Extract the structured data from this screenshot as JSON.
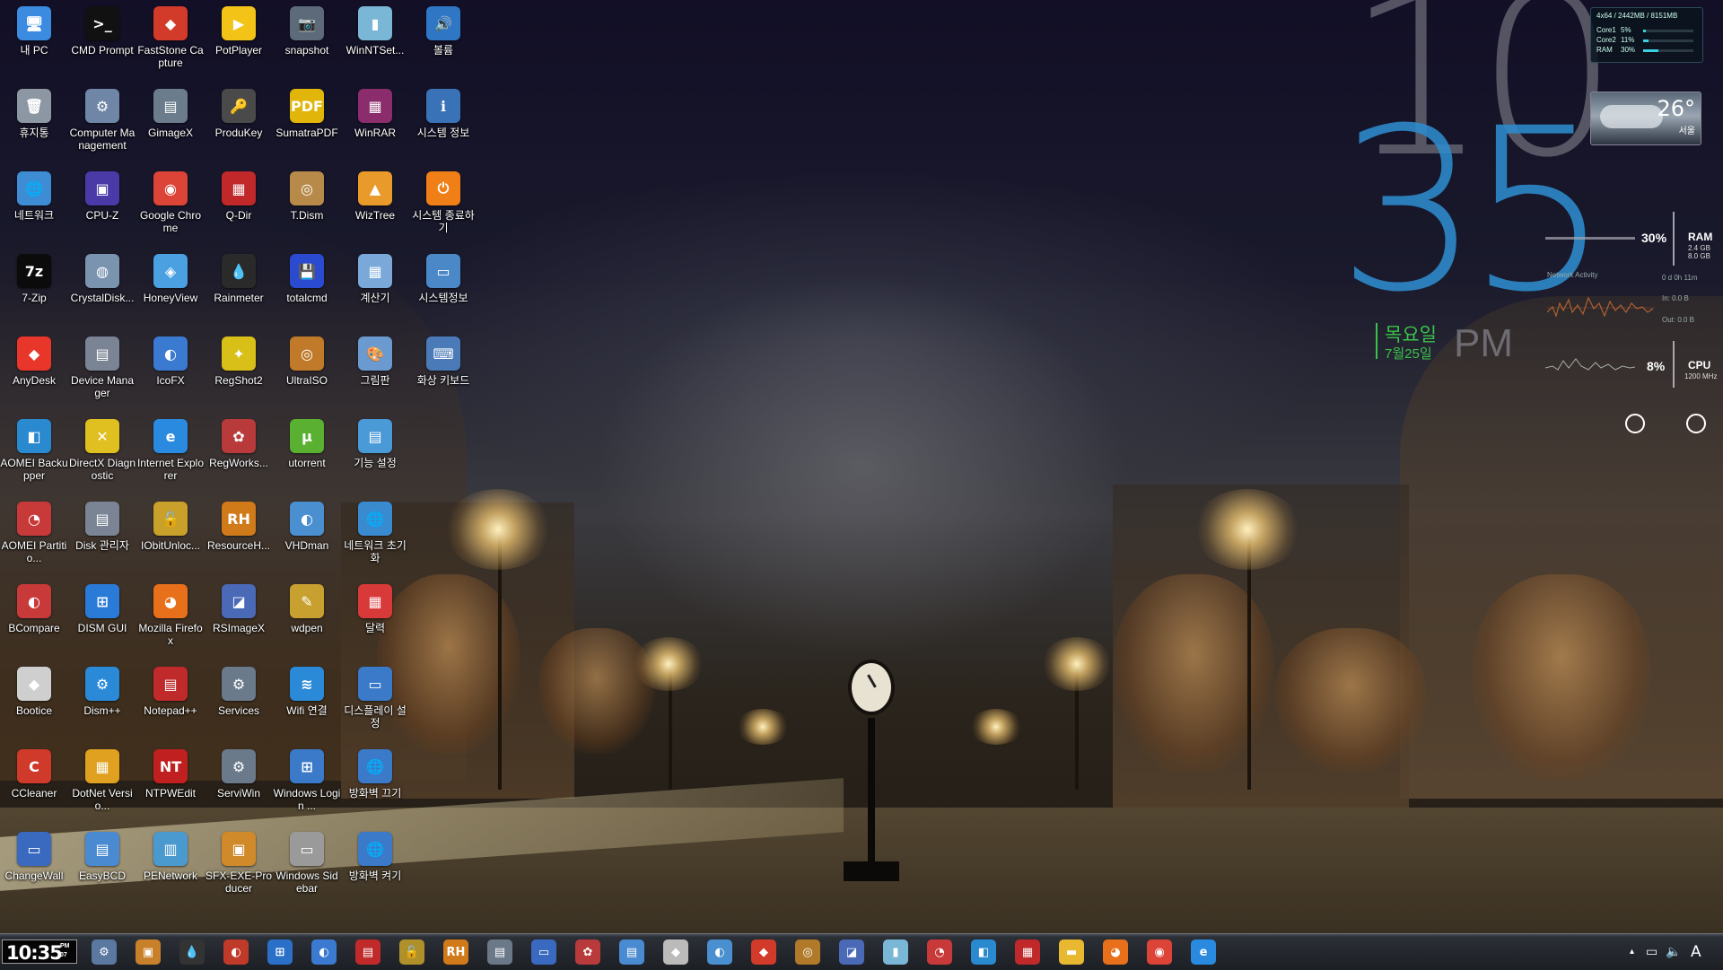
{
  "desktop": {
    "icons": [
      {
        "label": "내 PC",
        "glyph": "🖥",
        "color": "#3b8be0"
      },
      {
        "label": "CMD Prompt",
        "glyph": ">_",
        "color": "#111111"
      },
      {
        "label": "FastStone Capture",
        "glyph": "◆",
        "color": "#d23a2a"
      },
      {
        "label": "PotPlayer",
        "glyph": "▶",
        "color": "#f3c318"
      },
      {
        "label": "snapshot",
        "glyph": "📷",
        "color": "#5c6a7a"
      },
      {
        "label": "WinNTSet...",
        "glyph": "▮",
        "color": "#7ab6d6"
      },
      {
        "label": "볼륨",
        "glyph": "🔊",
        "color": "#2f76c4"
      },
      {
        "label": "휴지통",
        "glyph": "🗑",
        "color": "#8d97a3"
      },
      {
        "label": "Computer Management",
        "glyph": "⚙",
        "color": "#6f86a6"
      },
      {
        "label": "GimageX",
        "glyph": "▤",
        "color": "#6b7d8c"
      },
      {
        "label": "ProduKey",
        "glyph": "🔑",
        "color": "#4a4a4a"
      },
      {
        "label": "SumatraPDF",
        "glyph": "PDF",
        "color": "#e2b50a"
      },
      {
        "label": "WinRAR",
        "glyph": "▦",
        "color": "#8b2d6c"
      },
      {
        "label": "시스템 정보",
        "glyph": "ℹ",
        "color": "#3a72b8"
      },
      {
        "label": "네트워크",
        "glyph": "🌐",
        "color": "#3e8cd4"
      },
      {
        "label": "CPU-Z",
        "glyph": "▣",
        "color": "#4a3aa8"
      },
      {
        "label": "Google Chrome",
        "glyph": "◉",
        "color": "#db4437"
      },
      {
        "label": "Q-Dir",
        "glyph": "▦",
        "color": "#c0282a"
      },
      {
        "label": "T.Dism",
        "glyph": "◎",
        "color": "#b88a4a"
      },
      {
        "label": "WizTree",
        "glyph": "▲",
        "color": "#e89a2a"
      },
      {
        "label": "시스템 종료하기",
        "glyph": "⏻",
        "color": "#f07f18"
      },
      {
        "label": "7-Zip",
        "glyph": "7z",
        "color": "#0b0b0b"
      },
      {
        "label": "CrystalDisk...",
        "glyph": "◍",
        "color": "#7a94b0"
      },
      {
        "label": "HoneyView",
        "glyph": "◈",
        "color": "#4aa0e0"
      },
      {
        "label": "Rainmeter",
        "glyph": "💧",
        "color": "#2a2a2a"
      },
      {
        "label": "totalcmd",
        "glyph": "💾",
        "color": "#2a4ad0"
      },
      {
        "label": "계산기",
        "glyph": "▦",
        "color": "#7aa8d8"
      },
      {
        "label": "시스템정보",
        "glyph": "▭",
        "color": "#4a88c8"
      },
      {
        "label": "AnyDesk",
        "glyph": "◆",
        "color": "#e8362a"
      },
      {
        "label": "Device Manager",
        "glyph": "▤",
        "color": "#7a8494"
      },
      {
        "label": "IcoFX",
        "glyph": "◐",
        "color": "#3a7ad0"
      },
      {
        "label": "RegShot2",
        "glyph": "✦",
        "color": "#d8c018"
      },
      {
        "label": "UltraISO",
        "glyph": "◎",
        "color": "#c07a2a"
      },
      {
        "label": "그림판",
        "glyph": "🎨",
        "color": "#6a9ad0"
      },
      {
        "label": "화상 키보드",
        "glyph": "⌨",
        "color": "#4a7ab8"
      },
      {
        "label": "AOMEI Backupper",
        "glyph": "◧",
        "color": "#2a8ad0"
      },
      {
        "label": "DirectX Diagnostic",
        "glyph": "✕",
        "color": "#e0c020"
      },
      {
        "label": "Internet Explorer",
        "glyph": "e",
        "color": "#2a8ae0"
      },
      {
        "label": "RegWorks...",
        "glyph": "✿",
        "color": "#b83a3a"
      },
      {
        "label": "utorrent",
        "glyph": "μ",
        "color": "#5ab030"
      },
      {
        "label": "기능 설정",
        "glyph": "▤",
        "color": "#4a9ad8"
      },
      {
        "label": "AOMEI Partitio...",
        "glyph": "◔",
        "color": "#c83a3a"
      },
      {
        "label": "Disk 관리자",
        "glyph": "▤",
        "color": "#7a8494"
      },
      {
        "label": "IObitUnloc...",
        "glyph": "🔓",
        "color": "#c8a02a"
      },
      {
        "label": "ResourceH...",
        "glyph": "RH",
        "color": "#d07a1a"
      },
      {
        "label": "VHDman",
        "glyph": "◐",
        "color": "#4a90d0"
      },
      {
        "label": "네트워크 초기화",
        "glyph": "🌐",
        "color": "#3a8ad0"
      },
      {
        "label": "BCompare",
        "glyph": "◐",
        "color": "#c83a3a"
      },
      {
        "label": "DISM GUI",
        "glyph": "⊞",
        "color": "#2a7ad8"
      },
      {
        "label": "Mozilla Firefox",
        "glyph": "◕",
        "color": "#e8701a"
      },
      {
        "label": "RSImageX",
        "glyph": "◪",
        "color": "#4a6ab8"
      },
      {
        "label": "wdpen",
        "glyph": "✎",
        "color": "#c8a030"
      },
      {
        "label": "달력",
        "glyph": "▦",
        "color": "#d83a3a"
      },
      {
        "label": "Bootice",
        "glyph": "◆",
        "color": "#cfcfcf"
      },
      {
        "label": "Dism++",
        "glyph": "⚙",
        "color": "#2a8ad8"
      },
      {
        "label": "Notepad++",
        "glyph": "▤",
        "color": "#c02a2a"
      },
      {
        "label": "Services",
        "glyph": "⚙",
        "color": "#6a7a8a"
      },
      {
        "label": "Wifi 연결",
        "glyph": "≋",
        "color": "#2a8ad8"
      },
      {
        "label": "디스플레이 설정",
        "glyph": "▭",
        "color": "#3a7ac8"
      },
      {
        "label": "CCleaner",
        "glyph": "C",
        "color": "#d03a2a"
      },
      {
        "label": "DotNet Versio...",
        "glyph": "▦",
        "color": "#e0a020"
      },
      {
        "label": "NTPWEdit",
        "glyph": "NT",
        "color": "#c02020"
      },
      {
        "label": "ServiWin",
        "glyph": "⚙",
        "color": "#6a7a8a"
      },
      {
        "label": "Windows Login ...",
        "glyph": "⊞",
        "color": "#3a7ac8"
      },
      {
        "label": "방화벽 끄기",
        "glyph": "🌐",
        "color": "#3a7ac8"
      },
      {
        "label": "ChangeWall",
        "glyph": "▭",
        "color": "#3a6ac0"
      },
      {
        "label": "EasyBCD",
        "glyph": "▤",
        "color": "#4a8ad0"
      },
      {
        "label": "PENetwork",
        "glyph": "▥",
        "color": "#4a9ad0"
      },
      {
        "label": "SFX-EXE-Producer",
        "glyph": "▣",
        "color": "#d08a2a"
      },
      {
        "label": "Windows Sidebar",
        "glyph": "▭",
        "color": "#9a9a9a"
      },
      {
        "label": "방화벽 켜기",
        "glyph": "🌐",
        "color": "#3a7ac8"
      }
    ]
  },
  "widgets": {
    "clock": {
      "hour": "10",
      "minute": "35",
      "day": "목요일",
      "date": "7월25일",
      "ampm": "PM"
    },
    "sysmon": {
      "header": "4x64 / 2442MB / 8151MB",
      "rows": [
        {
          "name": "Core1",
          "pct": "5%",
          "level": 0.05
        },
        {
          "name": "Core2",
          "pct": "11%",
          "level": 0.11
        },
        {
          "name": "RAM",
          "pct": "30%",
          "level": 0.3
        }
      ]
    },
    "weather": {
      "temp": "26°",
      "city": "서울"
    },
    "ram": {
      "pct": "30%",
      "label": "RAM",
      "used": "2.4 GB",
      "total": "8.0 GB"
    },
    "network": {
      "title": "Network Activity",
      "uptime": "0 d 0h 11m",
      "in": "In: 0.0 B",
      "out": "Out: 0.0 B"
    },
    "cpu": {
      "pct": "8%",
      "label": "CPU",
      "freq": "1200 MHz"
    }
  },
  "taskbar": {
    "clock": {
      "time": "10:35",
      "ampm": "PM",
      "day": "07"
    },
    "items": [
      {
        "name": "computer-management",
        "glyph": "⚙",
        "color": "#5a78a0"
      },
      {
        "name": "sfx-exe-producer",
        "glyph": "▣",
        "color": "#c8802a"
      },
      {
        "name": "rainmeter",
        "glyph": "💧",
        "color": "#333333"
      },
      {
        "name": "bcompare",
        "glyph": "◐",
        "color": "#c03a2a"
      },
      {
        "name": "windows-login",
        "glyph": "⊞",
        "color": "#2a70c8"
      },
      {
        "name": "icofx",
        "glyph": "◐",
        "color": "#3a7ad0"
      },
      {
        "name": "notepad-plus",
        "glyph": "▤",
        "color": "#c02a2a"
      },
      {
        "name": "iobit-unlocker",
        "glyph": "🔓",
        "color": "#b0902a"
      },
      {
        "name": "resource-hacker",
        "glyph": "RH",
        "color": "#d07a1a"
      },
      {
        "name": "gimagex",
        "glyph": "▤",
        "color": "#6a7888"
      },
      {
        "name": "changewall",
        "glyph": "▭",
        "color": "#3a6ac0"
      },
      {
        "name": "regworks",
        "glyph": "✿",
        "color": "#b83a3a"
      },
      {
        "name": "easybcd",
        "glyph": "▤",
        "color": "#4a8ad0"
      },
      {
        "name": "bootice",
        "glyph": "◆",
        "color": "#bbbbbb"
      },
      {
        "name": "vhdman",
        "glyph": "◐",
        "color": "#4a90d0"
      },
      {
        "name": "faststone-capture",
        "glyph": "◆",
        "color": "#d23a2a"
      },
      {
        "name": "ultraiso",
        "glyph": "◎",
        "color": "#b07a2a"
      },
      {
        "name": "rsimagex",
        "glyph": "◪",
        "color": "#4a6ab8"
      },
      {
        "name": "winntsetup",
        "glyph": "▮",
        "color": "#7ab6d6"
      },
      {
        "name": "aomei-partition",
        "glyph": "◔",
        "color": "#c83a3a"
      },
      {
        "name": "aomei-backupper",
        "glyph": "◧",
        "color": "#2a8ad0"
      },
      {
        "name": "q-dir",
        "glyph": "▦",
        "color": "#c0282a"
      },
      {
        "name": "file-explorer",
        "glyph": "▬",
        "color": "#e8b830"
      },
      {
        "name": "firefox",
        "glyph": "◕",
        "color": "#e8701a"
      },
      {
        "name": "chrome",
        "glyph": "◉",
        "color": "#db4437"
      },
      {
        "name": "internet-explorer",
        "glyph": "e",
        "color": "#2a8ae0"
      }
    ],
    "tray": {
      "arrow": "▴",
      "network": "▭",
      "volume": "🔈",
      "ime": "A"
    }
  }
}
